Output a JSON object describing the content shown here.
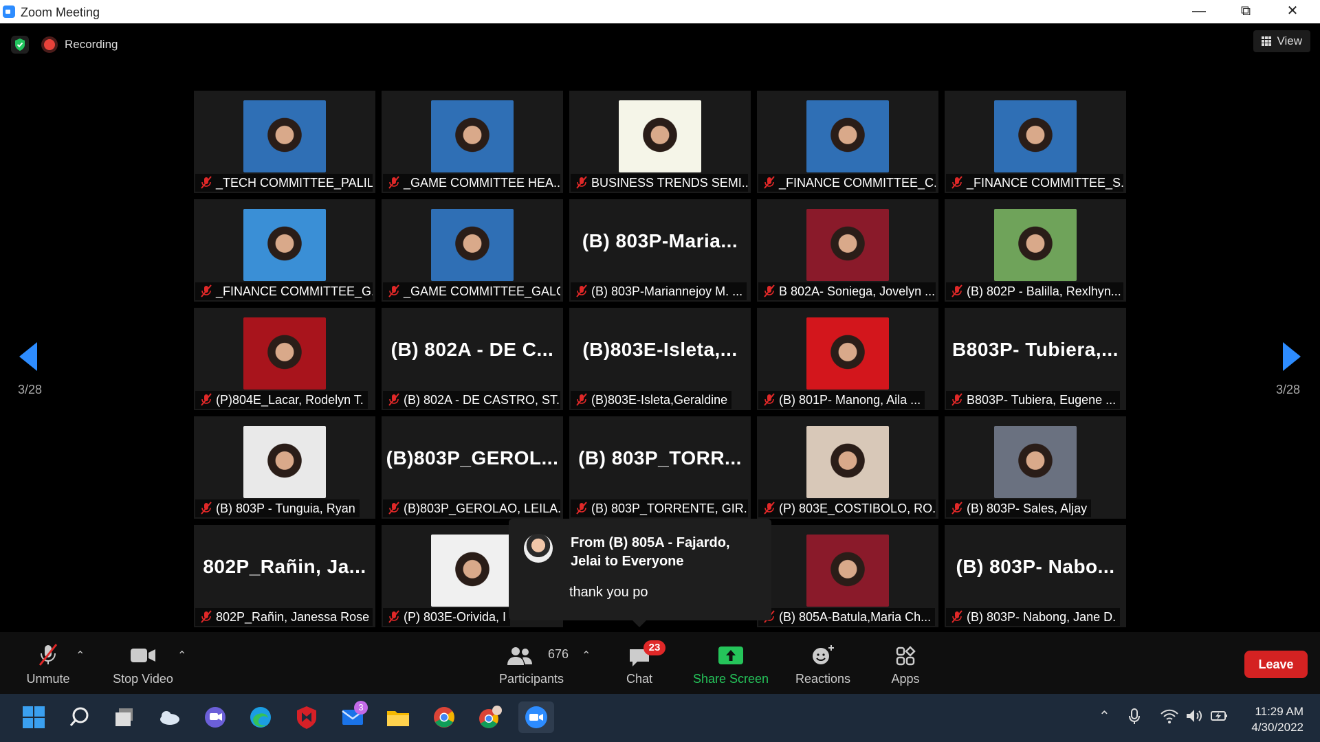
{
  "window": {
    "title": "Zoom Meeting",
    "controls": [
      "—",
      "⧉",
      "✕"
    ]
  },
  "topbar": {
    "recording_label": "Recording",
    "view_label": "View"
  },
  "pagination": {
    "left": "3/28",
    "right": "3/28"
  },
  "tiles": [
    {
      "name": "_TECH COMMITTEE_PALIL...",
      "type": "photo",
      "color": "#2f6fb5"
    },
    {
      "name": "_GAME COMMITTEE HEA...",
      "type": "photo",
      "color": "#2f6fb5"
    },
    {
      "name": "BUSINESS TRENDS SEMI...",
      "type": "photo",
      "color": "#f5f5e8"
    },
    {
      "name": "_FINANCE COMMITTEE_C...",
      "type": "photo",
      "color": "#2f6fb5"
    },
    {
      "name": "_FINANCE COMMITTEE_S...",
      "type": "photo",
      "color": "#2f6fb5"
    },
    {
      "name": "_FINANCE COMMITTEE_G...",
      "type": "photo",
      "color": "#3a8fd6"
    },
    {
      "name": "_GAME COMMITTEE_GALO",
      "type": "photo",
      "color": "#2f6fb5"
    },
    {
      "name": "(B) 803P-Mariannejoy M. ...",
      "type": "text",
      "big": "(B)  803P-Maria..."
    },
    {
      "name": "B 802A- Soniega, Jovelyn ...",
      "type": "photo",
      "color": "#8a1a2a"
    },
    {
      "name": "(B) 802P - Balilla, Rexlhyn...",
      "type": "photo",
      "color": "#6fa35a"
    },
    {
      "name": "(P)804E_Lacar, Rodelyn T.",
      "type": "photo",
      "color": "#a8141c"
    },
    {
      "name": "(B) 802A - DE CASTRO, ST...",
      "type": "text",
      "big": "(B) 802A - DE C..."
    },
    {
      "name": "(B)803E-Isleta,Geraldine",
      "type": "text",
      "big": "(B)803E-Isleta,..."
    },
    {
      "name": "(B) 801P- Manong, Aila ...",
      "type": "photo",
      "color": "#d3161c"
    },
    {
      "name": "B803P- Tubiera, Eugene ...",
      "type": "text",
      "big": "B803P-  Tubiera,..."
    },
    {
      "name": "(B) 803P - Tunguia, Ryan",
      "type": "photo",
      "color": "#e9e9e9"
    },
    {
      "name": "(B)803P_GEROLAO, LEILA...",
      "type": "text",
      "big": "(B)803P_GEROL..."
    },
    {
      "name": "(B) 803P_TORRENTE, GIR...",
      "type": "text",
      "big": "(B)  803P_TORR..."
    },
    {
      "name": "(P) 803E_COSTIBOLO, RO...",
      "type": "photo",
      "color": "#d8c8b8"
    },
    {
      "name": "(B) 803P- Sales, Aljay",
      "type": "photo",
      "color": "#6a7180"
    },
    {
      "name": "802P_Rañin, Janessa Rose",
      "type": "text",
      "big": "802P_Rañin,  Ja..."
    },
    {
      "name": "(P) 803E-Orivida, I",
      "type": "photo",
      "color": "#f0f0f0"
    },
    {
      "name": "",
      "type": "hidden"
    },
    {
      "name": "(B) 805A-Batula,Maria Ch...",
      "type": "photo",
      "color": "#8a1a2a"
    },
    {
      "name": "(B) 803P- Nabong, Jane D.",
      "type": "text",
      "big": "(B)  803P-  Nabo..."
    }
  ],
  "chat_popup": {
    "from": "From (B) 805A - Fajardo, Jelai to Everyone",
    "message": "thank you po"
  },
  "toolbar": {
    "unmute": "Unmute",
    "stop_video": "Stop Video",
    "participants": "Participants",
    "participant_count": "676",
    "chat": "Chat",
    "chat_badge": "23",
    "share_screen": "Share Screen",
    "reactions": "Reactions",
    "apps": "Apps",
    "leave": "Leave",
    "colors": {
      "share": "#25c45a",
      "leave": "#d42222",
      "accent": "#2d8cff"
    }
  },
  "taskbar": {
    "mail_badge": "3",
    "time": "11:29 AM",
    "date": "4/30/2022"
  }
}
